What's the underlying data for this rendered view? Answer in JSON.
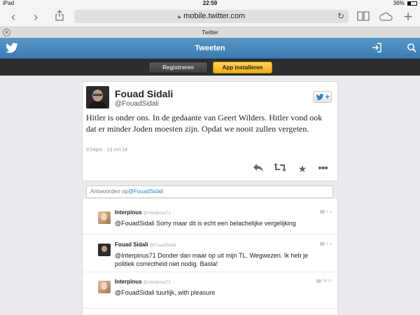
{
  "status_bar": {
    "device": "iPad",
    "time": "22:59",
    "battery": "36%"
  },
  "browser": {
    "url": "mobile.twitter.com",
    "tab_title": "Twitter",
    "icons": [
      "back-icon",
      "forward-icon",
      "share-icon",
      "lock-icon",
      "reload-icon",
      "bookmarks-icon",
      "icloud-icon",
      "new-tab-icon",
      "close-tab-icon"
    ]
  },
  "header": {
    "title": "Tweeten",
    "brand_color": "#4a8ac0"
  },
  "actionbar": {
    "register_label": "Registreren",
    "install_label": "App installeren",
    "install_color": "#f5b21b"
  },
  "tweet": {
    "author_name": "Fouad Sidali",
    "author_handle": "@FouadSidali",
    "text": "Hitler is onder ons. In de gedaante van Geert Wilders. Hitler vond ook dat er minder Joden moesten zijn. Opdat we nooit zullen vergeten.",
    "meta": "9:54pm · 13 mrt 14",
    "follow_plus": "+"
  },
  "reply_box": {
    "prefix": "Antwoorden op",
    "mention": "@FouadSidali"
  },
  "replies": [
    {
      "name": "Interpinus",
      "handle": "@Interpinus71",
      "text": "@FouadSidali Sorry maar dit is echt een belachelijke vergelijking",
      "time": "1 u"
    },
    {
      "name": "Fouad Sidali",
      "handle": "@FouadSidali",
      "text": "@Interpinus71 Donder dan maar op uit mijn TL. Wegwezen. Ik heb je politiek correctheid niet nodig. Basta!",
      "time": "1 u"
    },
    {
      "name": "Interpinus",
      "handle": "@Interpinus71",
      "text": "@FouadSidali tuurlijk, with pleasure",
      "time": "59 m"
    }
  ]
}
